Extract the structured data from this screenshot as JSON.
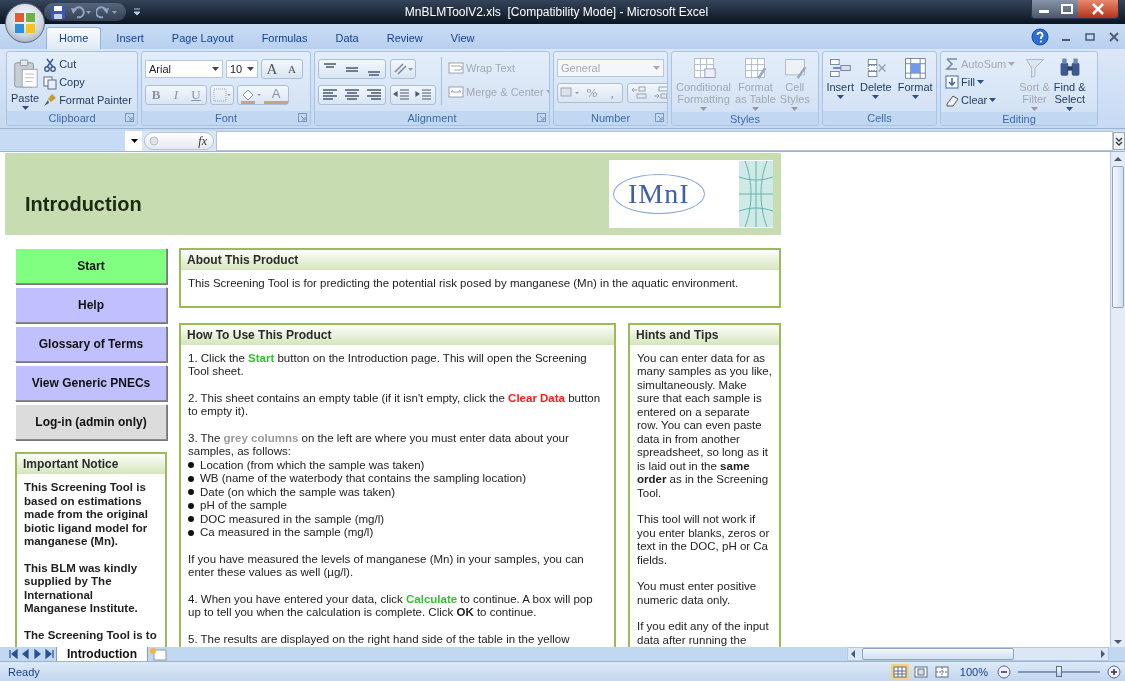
{
  "window": {
    "title": "MnBLMToolV2.xls  [Compatibility Mode] - Microsoft Excel"
  },
  "ribbon_tabs": [
    {
      "label": "Home",
      "selected": true
    },
    {
      "label": "Insert",
      "selected": false
    },
    {
      "label": "Page Layout",
      "selected": false
    },
    {
      "label": "Formulas",
      "selected": false
    },
    {
      "label": "Data",
      "selected": false
    },
    {
      "label": "Review",
      "selected": false
    },
    {
      "label": "View",
      "selected": false
    }
  ],
  "ribbon_groups": [
    {
      "kind": "clipboard",
      "label": "Clipboard",
      "launcher": true,
      "paste": "Paste",
      "small_buttons": [
        {
          "label": "Cut",
          "disabled": false
        },
        {
          "label": "Copy",
          "disabled": false
        },
        {
          "label": "Format Painter",
          "disabled": false
        }
      ]
    },
    {
      "kind": "font",
      "label": "Font",
      "launcher": true,
      "font_name": "Arial",
      "font_size": "10",
      "size_buttons": [
        "A",
        "A"
      ],
      "style_buttons": [
        "B",
        "I",
        "U"
      ],
      "color_button": "A"
    },
    {
      "kind": "alignment",
      "label": "Alignment",
      "launcher": true,
      "wrap_text": {
        "label": "Wrap Text",
        "disabled": true
      },
      "merge": {
        "label": "Merge & Center",
        "disabled": true
      }
    },
    {
      "kind": "number",
      "label": "Number",
      "launcher": true,
      "format": {
        "value": "General",
        "disabled": true
      },
      "percent": "%",
      "comma": ","
    },
    {
      "kind": "styles",
      "label": "Styles",
      "launcher": false,
      "big_buttons": [
        {
          "lines": [
            "Conditional",
            "Formatting"
          ],
          "disabled": true
        },
        {
          "lines": [
            "Format",
            "as Table"
          ],
          "disabled": true
        },
        {
          "lines": [
            "Cell",
            "Styles"
          ],
          "disabled": true
        }
      ]
    },
    {
      "kind": "cells",
      "label": "Cells",
      "launcher": false,
      "big_buttons": [
        {
          "lines": [
            "Insert"
          ],
          "disabled": false
        },
        {
          "lines": [
            "Delete"
          ],
          "disabled": false
        },
        {
          "lines": [
            "Format"
          ],
          "disabled": false
        }
      ]
    },
    {
      "kind": "editing",
      "label": "Editing",
      "launcher": false,
      "small_buttons": [
        {
          "label": "AutoSum",
          "disabled": true
        },
        {
          "label": "Fill",
          "disabled": false
        },
        {
          "label": "Clear",
          "disabled": false
        }
      ],
      "big_buttons": [
        {
          "lines": [
            "Sort &",
            "Filter"
          ],
          "disabled": true
        },
        {
          "lines": [
            "Find &",
            "Select"
          ],
          "disabled": false
        }
      ]
    }
  ],
  "formula_bar": {
    "function_label": "fx"
  },
  "sheet": {
    "title": "Introduction",
    "logo_text": "IMnI",
    "nav_buttons": [
      {
        "label": "Start",
        "color": "#80ff80"
      },
      {
        "label": "Help",
        "color": "#c0c0ff"
      },
      {
        "label": "Glossary of Terms",
        "color": "#c0c0ff"
      },
      {
        "label": "View Generic PNECs",
        "color": "#c0c0ff"
      },
      {
        "label": "Log-in (admin only)",
        "color": "#dcdcdc"
      }
    ],
    "notice": {
      "title": "Important Notice",
      "paragraphs": [
        "This Screening Tool is based on estimations made from the original biotic ligand model for manganese (Mn).",
        "This BLM was kindly supplied by The International Manganese Institute.",
        "The Screening Tool is to"
      ]
    },
    "about": {
      "title": "About This Product",
      "paragraphs": [
        "This Screening Tool is for predicting the potential risk posed by manganese (Mn) in the aquatic environment."
      ]
    },
    "how_to": {
      "title": "How To Use This Product",
      "blocks": [
        {
          "kind": "text",
          "segments": [
            {
              "text": "1. Click the "
            },
            {
              "text": "Start",
              "color": "#33c033"
            },
            {
              "text": " button on the Introduction page.  This will open the Screening Tool sheet."
            }
          ]
        },
        {
          "kind": "text",
          "segments": [
            {
              "text": "2. This sheet contains an empty table (if it isn't empty, click the "
            },
            {
              "text": "Clear Data",
              "color": "#ff1a1a"
            },
            {
              "text": " button to empty it)."
            }
          ]
        },
        {
          "kind": "text",
          "segments": [
            {
              "text": "3. The "
            },
            {
              "text": "grey columns",
              "color": "#999999"
            },
            {
              "text": " on the left are where you must enter data about your samples, as follows:"
            }
          ]
        },
        {
          "kind": "list",
          "items": [
            "Location (from which the sample was taken)",
            "WB (name of the waterbody that contains the sampling location)",
            "Date (on which the sample was taken)",
            "pH of the sample",
            "DOC measured in the sample (mg/l)",
            "Ca measured in the sample (mg/l)"
          ]
        },
        {
          "kind": "text",
          "segments": [
            {
              "text": "If you have measured the levels of manganese (Mn) in your samples, you can enter these values as well (µg/l)."
            }
          ]
        },
        {
          "kind": "text",
          "segments": [
            {
              "text": "4. When you have entered your data, click "
            },
            {
              "text": "Calculate",
              "color": "#33c033"
            },
            {
              "text": " to continue.  A box will pop up to tell you when the calculation is complete. Click **OK** to continue."
            }
          ]
        },
        {
          "kind": "text",
          "segments": [
            {
              "text": "5. The results are displayed on the right hand side of the table in the yellow"
            }
          ]
        }
      ]
    },
    "hints": {
      "title": "Hints and Tips",
      "paragraphs": [
        "You can enter data for as many samples as you like, simultaneously.  Make sure that each sample is entered on a separate row.  You can even paste data in from another spreadsheet, so long as it is laid out in the **same order** as in the Screening Tool.",
        "This tool will not work if you enter blanks, zeros or text in the DOC, pH or Ca fields.",
        "You must enter positive numeric data only.",
        "If you edit any of the input data after running the"
      ]
    }
  },
  "sheet_tabs": [
    {
      "label": "Introduction",
      "selected": true
    }
  ],
  "status_bar": {
    "text": "Ready",
    "views": [
      {
        "selected": true
      },
      {
        "selected": false
      },
      {
        "selected": false
      }
    ],
    "zoom": "100%",
    "zoom_slider": {
      "level": 0.5
    }
  }
}
